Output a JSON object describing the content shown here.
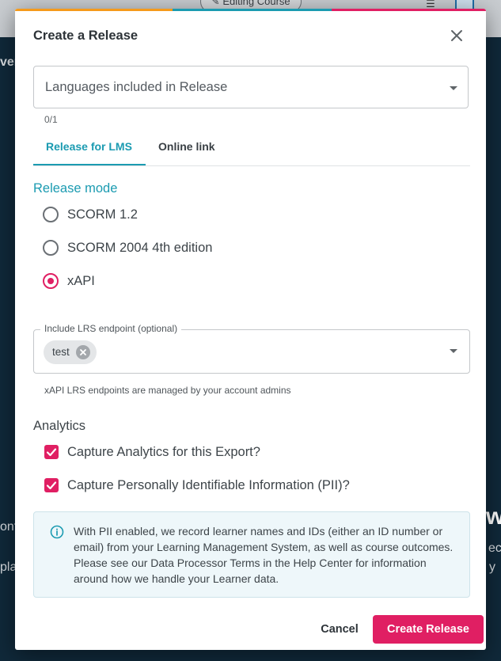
{
  "background": {
    "editing_pill_label": "Editing Course",
    "fragment_left_1": "ver",
    "fragment_left_2": "onfi",
    "fragment_left_3": "pla",
    "fragment_right_1": "w",
    "fragment_right_2": "ec",
    "fragment_right_3": "y"
  },
  "modal": {
    "title": "Create a Release",
    "languages_select": {
      "placeholder": "Languages included in Release",
      "counter": "0/1"
    },
    "tabs": [
      {
        "label": "Release for LMS",
        "active": true
      },
      {
        "label": "Online link",
        "active": false
      }
    ],
    "release_mode": {
      "label": "Release mode",
      "options": [
        {
          "label": "SCORM 1.2",
          "selected": false
        },
        {
          "label": "SCORM 2004 4th edition",
          "selected": false
        },
        {
          "label": "xAPI",
          "selected": true
        }
      ]
    },
    "lrs": {
      "legend": "Include LRS endpoint (optional)",
      "chips": [
        "test"
      ],
      "helper": "xAPI LRS endpoints are managed by your account admins"
    },
    "analytics": {
      "label": "Analytics",
      "checkboxes": [
        {
          "label": "Capture Analytics for this Export?",
          "checked": true
        },
        {
          "label": "Capture Personally Identifiable Information (PII)?",
          "checked": true
        }
      ]
    },
    "info": {
      "text": "With PII enabled, we record learner names and IDs (either an ID number or email) from your Learning Management System, as well as course outcomes. Please see our Data Processor Terms in the Help Center for information around how we handle your Learner data."
    },
    "buttons": {
      "cancel": "Cancel",
      "create": "Create Release"
    }
  },
  "colors": {
    "accent_teal": "#1b9bb1",
    "accent_pink": "#e01f63",
    "accent_orange": "#f59a1b",
    "overlay_dark": "#10293a"
  }
}
